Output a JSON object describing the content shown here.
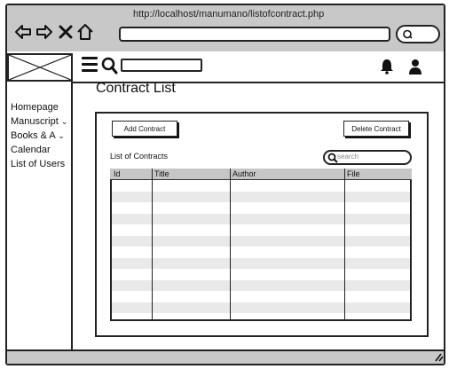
{
  "browser": {
    "url": "http://localhost/manumano/listofcontract.php",
    "icons": [
      "back-arrow",
      "forward-arrow",
      "close-x",
      "home"
    ]
  },
  "topnav": {
    "icons": [
      "hamburger-menu",
      "search",
      "bell",
      "user"
    ]
  },
  "sidebar": {
    "items": [
      {
        "label": "Homepage"
      },
      {
        "label": "Manuscript"
      },
      {
        "label": "Books & A"
      },
      {
        "label": "Calendar"
      },
      {
        "label": "List of Users"
      }
    ]
  },
  "page": {
    "title": "Contract List",
    "add_button": "Add Contract",
    "delete_button": "Delete Contract",
    "list_label": "List of Contracts",
    "search_placeholder": "search"
  },
  "table": {
    "columns": [
      "Id",
      "Title",
      "Author",
      "File"
    ],
    "rows": [
      [
        "",
        "",
        "",
        ""
      ],
      [
        "",
        "",
        "",
        ""
      ],
      [
        "",
        "",
        "",
        ""
      ],
      [
        "",
        "",
        "",
        ""
      ],
      [
        "",
        "",
        "",
        ""
      ],
      [
        "",
        "",
        "",
        ""
      ],
      [
        "",
        "",
        "",
        ""
      ],
      [
        "",
        "",
        "",
        ""
      ],
      [
        "",
        "",
        "",
        ""
      ],
      [
        "",
        "",
        "",
        ""
      ],
      [
        "",
        "",
        "",
        ""
      ],
      [
        "",
        "",
        "",
        ""
      ],
      [
        "",
        "",
        "",
        ""
      ]
    ]
  },
  "colors": {
    "browser_chrome": "#c8c8c8",
    "table_header": "#c6c6c6",
    "row_stripe": "#e9e9e9",
    "stroke": "#222222"
  }
}
